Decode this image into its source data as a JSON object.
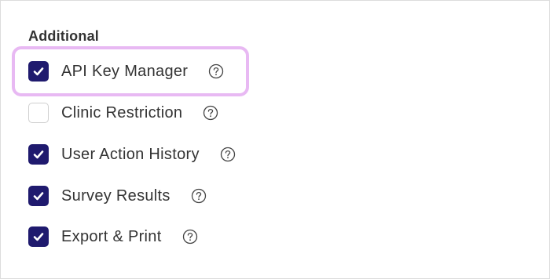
{
  "section": {
    "title": "Additional"
  },
  "options": [
    {
      "label": "API Key Manager",
      "checked": true,
      "help_icon": "question-circle-icon",
      "highlighted": true
    },
    {
      "label": "Clinic Restriction",
      "checked": false,
      "help_icon": "question-circle-icon",
      "highlighted": false
    },
    {
      "label": "User Action History",
      "checked": true,
      "help_icon": "question-circle-icon",
      "highlighted": false
    },
    {
      "label": "Survey Results",
      "checked": true,
      "help_icon": "question-circle-icon",
      "highlighted": false
    },
    {
      "label": "Export & Print",
      "checked": true,
      "help_icon": "question-circle-icon",
      "highlighted": false
    }
  ],
  "colors": {
    "checkbox_checked": "#1f1a6e",
    "highlight": "#e8b9f3",
    "text": "#333333"
  }
}
